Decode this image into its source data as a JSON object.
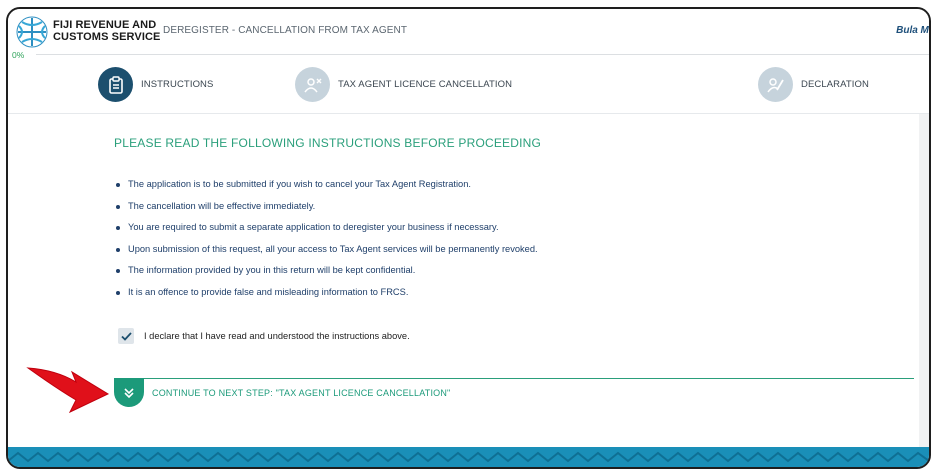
{
  "header": {
    "org_line1": "FIJI REVENUE AND",
    "org_line2": "CUSTOMS SERVICE",
    "page_title": "DEREGISTER - CANCELLATION FROM TAX AGENT",
    "greeting": "Bula Mo",
    "progress": "0%"
  },
  "steps": [
    {
      "label": "INSTRUCTIONS",
      "icon": "clipboard-icon",
      "state": "active"
    },
    {
      "label": "TAX AGENT LICENCE CANCELLATION",
      "icon": "user-remove-icon",
      "state": "inactive"
    },
    {
      "label": "DECLARATION",
      "icon": "signature-icon",
      "state": "inactive"
    }
  ],
  "main": {
    "heading": "PLEASE READ THE FOLLOWING INSTRUCTIONS BEFORE PROCEEDING",
    "instructions": [
      "The application is to be submitted if you wish to cancel your Tax Agent Registration.",
      "The cancellation will be effective immediately.",
      "You are required to submit a separate application to deregister your business if necessary.",
      "Upon submission of this request, all your access to Tax Agent services will be permanently revoked.",
      "The information provided by you in this return will be kept confidential.",
      "It is an offence to provide false and misleading information to FRCS."
    ],
    "declaration": "I declare that I have read and understood the instructions above.",
    "declaration_checked": true,
    "continue_label": "CONTINUE TO NEXT STEP: \"TAX AGENT LICENCE CANCELLATION\""
  },
  "colors": {
    "primary": "#1c4f6e",
    "accent": "#2a9f7b",
    "text": "#1f3f6a",
    "footer": "#1a8fb8",
    "annotation_arrow": "#e0101a"
  }
}
